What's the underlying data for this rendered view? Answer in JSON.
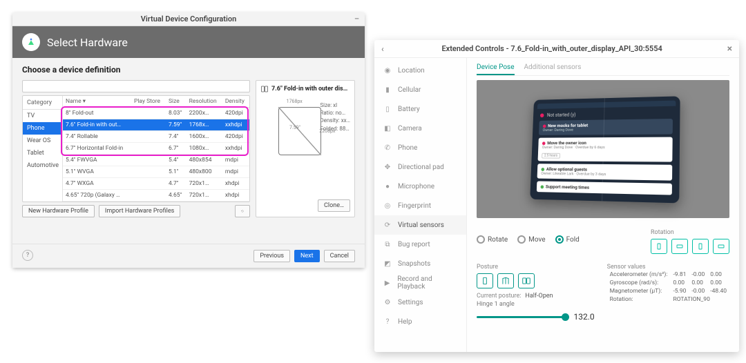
{
  "vdc": {
    "window_title": "Virtual Device Configuration",
    "header_title": "Select Hardware",
    "subtitle": "Choose a device definition",
    "search_placeholder": "",
    "category_header": "Category",
    "categories": [
      "TV",
      "Phone",
      "Wear OS",
      "Tablet",
      "Automotive"
    ],
    "selected_category_index": 1,
    "columns": {
      "name": "Name ▾",
      "play": "Play Store",
      "size": "Size",
      "res": "Resolution",
      "density": "Density"
    },
    "devices": [
      {
        "name": "8\" Fold-out",
        "play": "",
        "size": "8.03\"",
        "res": "2200x…",
        "density": "420dpi"
      },
      {
        "name": "7.6\" Fold-in with out…",
        "play": "",
        "size": "7.59\"",
        "res": "1768x…",
        "density": "xxhdpi"
      },
      {
        "name": "7.4\" Rollable",
        "play": "",
        "size": "7.4\"",
        "res": "1600x…",
        "density": "420dpi"
      },
      {
        "name": "6.7\" Horizontal Fold-in",
        "play": "",
        "size": "6.7\"",
        "res": "1080x…",
        "density": "xxhdpi"
      },
      {
        "name": "5.4\" FWVGA",
        "play": "",
        "size": "5.4\"",
        "res": "480x854",
        "density": "mdpi"
      },
      {
        "name": "5.1\" WVGA",
        "play": "",
        "size": "5.1\"",
        "res": "480x800",
        "density": "mdpi"
      },
      {
        "name": "4.7\" WXGA",
        "play": "",
        "size": "4.7\"",
        "res": "720x1…",
        "density": "xhdpi"
      },
      {
        "name": "4.65\" 720p (Galaxy …",
        "play": "",
        "size": "4.65\"",
        "res": "720x1…",
        "density": "xhdpi"
      }
    ],
    "selected_device_index": 1,
    "buttons": {
      "new_profile": "New Hardware Profile",
      "import": "Import Hardware Profiles",
      "clone": "Clone…",
      "prev": "Previous",
      "next": "Next",
      "cancel": "Cancel"
    },
    "preview": {
      "title": "7.6\" Fold-in with outer dis…",
      "width_label": "1768px",
      "height_label": "2208px",
      "diag_label": "7.59\"",
      "spec_size": "Size:   xl",
      "spec_ratio": "Ratio:  no…",
      "spec_density": "Density: xx…",
      "spec_folded": "Folded: 88…"
    }
  },
  "ec": {
    "window_title": "Extended Controls - 7.6_Fold-in_with_outer_display_API_30:5554",
    "sidebar": [
      {
        "icon": "location-icon",
        "label": "Location"
      },
      {
        "icon": "cellular-icon",
        "label": "Cellular"
      },
      {
        "icon": "battery-icon",
        "label": "Battery"
      },
      {
        "icon": "camera-icon",
        "label": "Camera"
      },
      {
        "icon": "phone-icon",
        "label": "Phone"
      },
      {
        "icon": "dpad-icon",
        "label": "Directional pad"
      },
      {
        "icon": "microphone-icon",
        "label": "Microphone"
      },
      {
        "icon": "fingerprint-icon",
        "label": "Fingerprint"
      },
      {
        "icon": "sensors-icon",
        "label": "Virtual sensors"
      },
      {
        "icon": "bug-icon",
        "label": "Bug report"
      },
      {
        "icon": "snapshot-icon",
        "label": "Snapshots"
      },
      {
        "icon": "record-icon",
        "label": "Record and Playback"
      },
      {
        "icon": "settings-icon",
        "label": "Settings"
      },
      {
        "icon": "help-icon",
        "label": "Help"
      }
    ],
    "selected_sidebar_index": 8,
    "tabs": {
      "pose": "Device Pose",
      "sensors": "Additional sensors"
    },
    "selected_tab": "pose",
    "mock": {
      "header": "Not started (y)",
      "cards": [
        {
          "title": "New mocks for tablet",
          "sub": "Owner: Daring Dove",
          "dot": "#e91e63"
        },
        {
          "title": "Move the owner icon",
          "sub": "Owner: Daring Dove · Overdue by 6 days",
          "tag": "2.5 hours",
          "dot": "#e91e63"
        },
        {
          "title": "Allow optional guests",
          "sub": "Owner: Likeable Lark · Overdue by 3 days",
          "dot": "#4caf50"
        },
        {
          "title": "Support meeting times",
          "sub": "",
          "dot": "#4caf50"
        }
      ]
    },
    "radios": {
      "rotate": "Rotate",
      "move": "Move",
      "fold": "Fold"
    },
    "selected_radio": "fold",
    "posture_label": "Posture",
    "rotation_label": "Rotation",
    "current_posture_label": "Current posture:",
    "current_posture_value": "Half-Open",
    "hinge_label": "Hinge 1 angle",
    "hinge_value": "132.0",
    "sensor_values_label": "Sensor values",
    "sensors": {
      "accel": {
        "label": "Accelerometer (m/s²):",
        "x": "-9.81",
        "y": "-0.00",
        "z": "0.00"
      },
      "gyro": {
        "label": "Gyroscope (rad/s):",
        "x": "0.00",
        "y": "0.00",
        "z": "0.00"
      },
      "magnet": {
        "label": "Magnetometer (μT):",
        "x": "-5.90",
        "y": "-0.00",
        "z": "-48.40"
      },
      "rotation": {
        "label": "Rotation:",
        "value": "ROTATION_90"
      }
    }
  }
}
